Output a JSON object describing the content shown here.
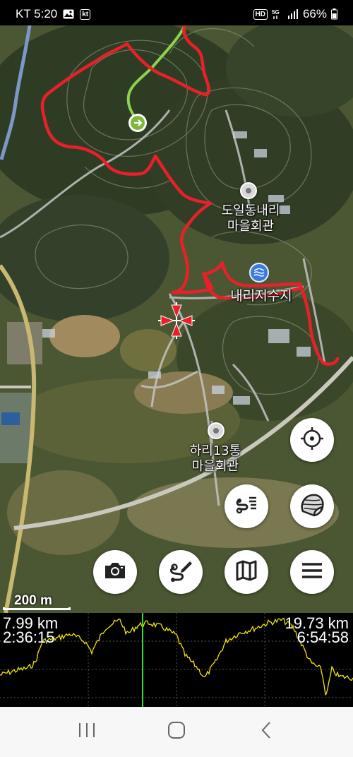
{
  "status_bar": {
    "carrier_time": "KT 5:20",
    "battery": "66%",
    "icons": [
      "gallery-icon",
      "kt-app-icon",
      "hd-icon",
      "5g-icon",
      "signal-icon",
      "battery-icon"
    ]
  },
  "map": {
    "poi": [
      {
        "label_line1": "도일동내리",
        "label_line2": "마을회관"
      },
      {
        "label_line1": "하리13통",
        "label_line2": "마을회관"
      }
    ],
    "reservoir_label": "내리저수지",
    "scale_label": "200 m",
    "track_color": "#e8202a",
    "planned_route_color": "#8fd14f",
    "buttons": {
      "locate": "crosshair-icon",
      "route_list": "route-list-icon",
      "map_layers": "map-layers-icon",
      "camera": "camera-icon",
      "draw_route": "draw-route-icon",
      "map": "map-icon",
      "menu": "menu-icon"
    }
  },
  "elevation": {
    "distance_current": "7.99 km",
    "time_current": "2:36:15",
    "distance_total": "19.73 km",
    "time_total": "6:54:58",
    "profile_color": "#f5e600",
    "cursor_color": "#33dd33"
  },
  "navbar": {
    "icons": [
      "recent-apps-icon",
      "home-icon",
      "back-icon"
    ]
  }
}
